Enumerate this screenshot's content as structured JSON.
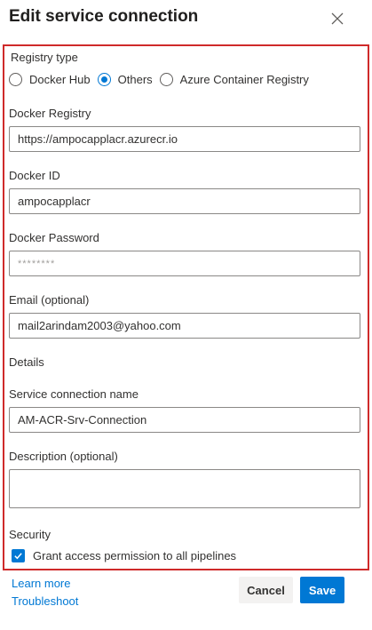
{
  "dialog": {
    "title": "Edit service connection"
  },
  "registry_type": {
    "label": "Registry type",
    "options": [
      {
        "label": "Docker Hub",
        "checked": false
      },
      {
        "label": "Others",
        "checked": true
      },
      {
        "label": "Azure Container Registry",
        "checked": false
      }
    ]
  },
  "fields": {
    "docker_registry": {
      "label": "Docker Registry",
      "value": "https://ampocapplacr.azurecr.io"
    },
    "docker_id": {
      "label": "Docker ID",
      "value": "ampocapplacr"
    },
    "docker_password": {
      "label": "Docker Password",
      "value": "********"
    },
    "email": {
      "label": "Email (optional)",
      "value": "mail2arindam2003@yahoo.com"
    },
    "details_heading": "Details",
    "service_connection_name": {
      "label": "Service connection name",
      "value": "AM-ACR-Srv-Connection"
    },
    "description": {
      "label": "Description (optional)",
      "value": ""
    }
  },
  "security": {
    "heading": "Security",
    "grant_access_label": "Grant access permission to all pipelines",
    "grant_access_checked": true
  },
  "footer": {
    "learn_more": "Learn more",
    "troubleshoot": "Troubleshoot",
    "cancel_label": "Cancel",
    "save_label": "Save"
  },
  "colors": {
    "accent": "#0078d4",
    "highlight_border": "#cf2a2a"
  }
}
